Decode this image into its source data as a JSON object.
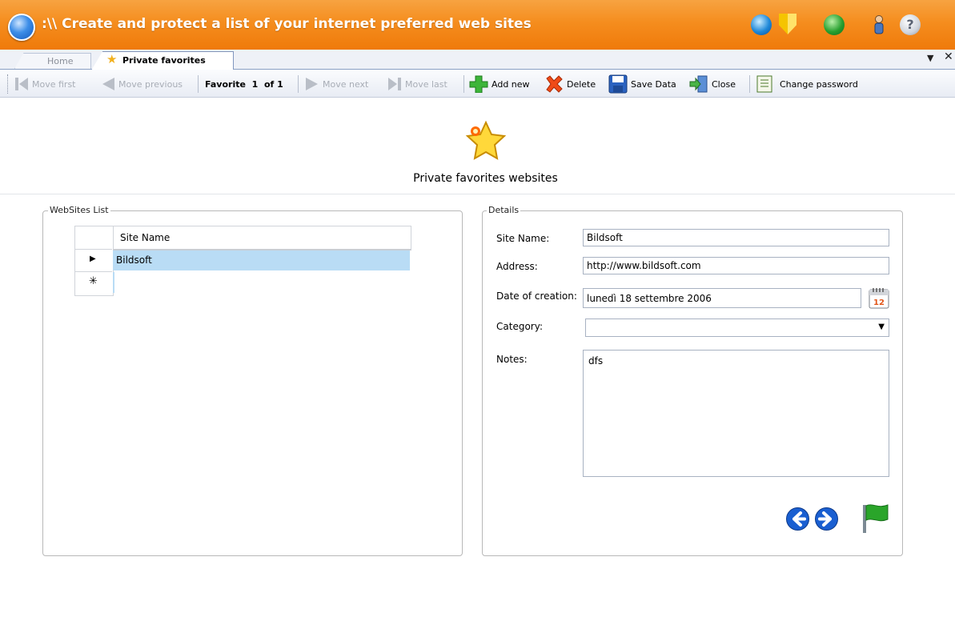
{
  "window": {
    "title": ":\\\\ Create and protect a list of your internet preferred web sites"
  },
  "tabs": [
    {
      "label": "Home",
      "active": false
    },
    {
      "label": "Private favorites",
      "active": true
    }
  ],
  "toolbar": {
    "move_first": "Move first",
    "move_previous": "Move previous",
    "record_word": "Favorite",
    "record_index": "1",
    "record_of": "of 1",
    "move_next": "Move next",
    "move_last": "Move last",
    "add_new": "Add new",
    "delete": "Delete",
    "save": "Save Data",
    "close": "Close",
    "change_password": "Change password"
  },
  "page": {
    "title": "Private favorites websites"
  },
  "websites_list": {
    "legend": "WebSites List",
    "column": "Site Name",
    "rows": [
      {
        "marker": "▶",
        "site_name": "Bildsoft"
      },
      {
        "marker": "✳",
        "site_name": ""
      }
    ]
  },
  "details": {
    "legend": "Details",
    "site_name_label": "Site Name:",
    "site_name_value": "Bildsoft",
    "address_label": "Address:",
    "address_value": "http://www.bildsoft.com",
    "date_label": "Date of creation:",
    "date_value": "lunedì 18 settembre 2006",
    "calendar_day": "12",
    "category_label": "Category:",
    "category_value": "",
    "notes_label": "Notes:",
    "notes_value": "dfs"
  },
  "colors": {
    "titlebar": "#f58d1e",
    "selected_row": "#b9dcf5",
    "nav_arrow": "#1a5fd1",
    "flag": "#2aa52a"
  }
}
